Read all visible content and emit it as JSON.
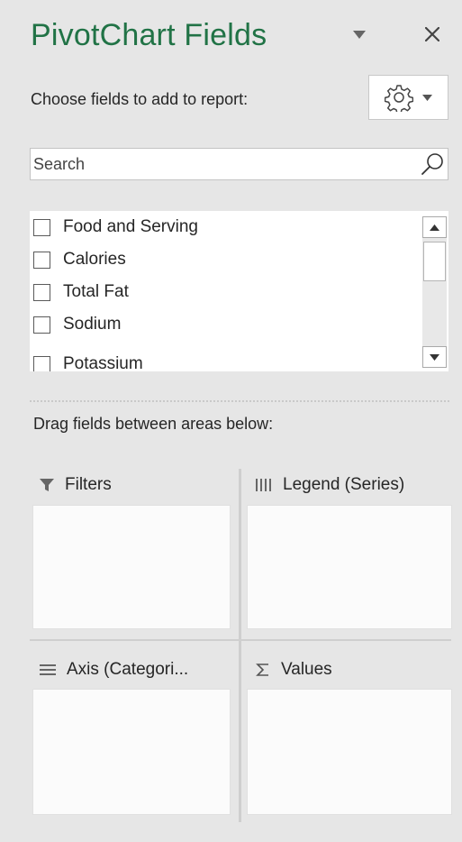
{
  "pane": {
    "title": "PivotChart Fields",
    "title_dropdown_icon": "triangle-down-icon",
    "close_icon": "close-icon",
    "accent_color": "#217346"
  },
  "choose": {
    "label": "Choose fields to add to report:",
    "tools_icon": "gear-icon",
    "tools_dropdown_icon": "triangle-down-icon"
  },
  "search": {
    "placeholder": "Search",
    "icon": "search-icon"
  },
  "fields": [
    {
      "label": "Food and Serving",
      "checked": false
    },
    {
      "label": "Calories",
      "checked": false
    },
    {
      "label": "Total Fat",
      "checked": false
    },
    {
      "label": "Sodium",
      "checked": false
    },
    {
      "label": "Potassium",
      "checked": false
    }
  ],
  "drag_label": "Drag fields between areas below:",
  "areas": {
    "filters": {
      "label": "Filters",
      "icon": "filter-icon"
    },
    "legend": {
      "label": "Legend (Series)",
      "icon": "columns-icon"
    },
    "axis": {
      "label": "Axis (Categori...",
      "icon": "rows-icon"
    },
    "values": {
      "label": "Values",
      "icon": "sigma-icon"
    }
  }
}
